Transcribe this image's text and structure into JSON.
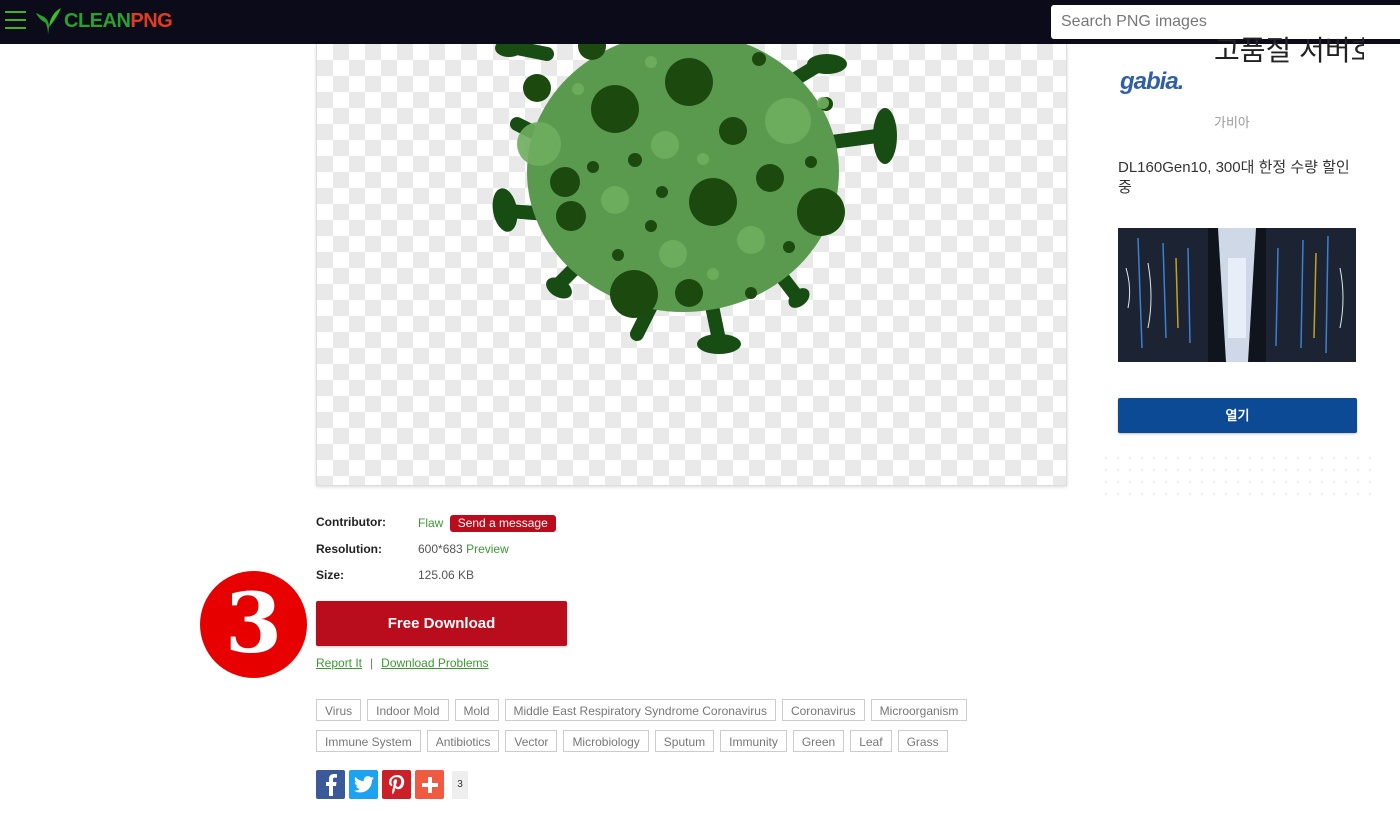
{
  "header": {
    "logo_text_1": "CLEAN",
    "logo_text_2": "PNG",
    "search_placeholder": "Search PNG images",
    "colors": {
      "bar": "#0b0b1a",
      "accent_green": "#2ba02d",
      "accent_red": "#e33b22"
    }
  },
  "details": {
    "contributor_label": "Contributor:",
    "contributor_name": "Flaw",
    "send_message_label": "Send a message",
    "resolution_label": "Resolution:",
    "resolution_value": "600*683",
    "preview_link": "Preview",
    "size_label": "Size:",
    "size_value": "125.06 KB"
  },
  "step_badge": "3",
  "download": {
    "button_label": "Free Download",
    "report_link": "Report It",
    "separator": "|",
    "problems_link": "Download Problems",
    "button_color": "#b90c1c"
  },
  "tags_row1": [
    "Virus",
    "Indoor Mold",
    "Mold",
    "Middle East Respiratory Syndrome Coronavirus",
    "Coronavirus",
    "Microorganism"
  ],
  "tags_row2": [
    "Immune System",
    "Antibiotics",
    "Vector",
    "Microbiology",
    "Sputum",
    "Immunity",
    "Green",
    "Leaf",
    "Grass"
  ],
  "share": {
    "icons": [
      "facebook-icon",
      "twitter-icon",
      "pinterest-icon",
      "plus-icon"
    ],
    "count": "3"
  },
  "ad": {
    "brand_logo": "gabia.",
    "title": "고품질 서버호…",
    "brand": "가비아",
    "description": "DL160Gen10, 300대 한정 수량 할인 중",
    "button_label": "열기",
    "button_color": "#0c4a96"
  }
}
